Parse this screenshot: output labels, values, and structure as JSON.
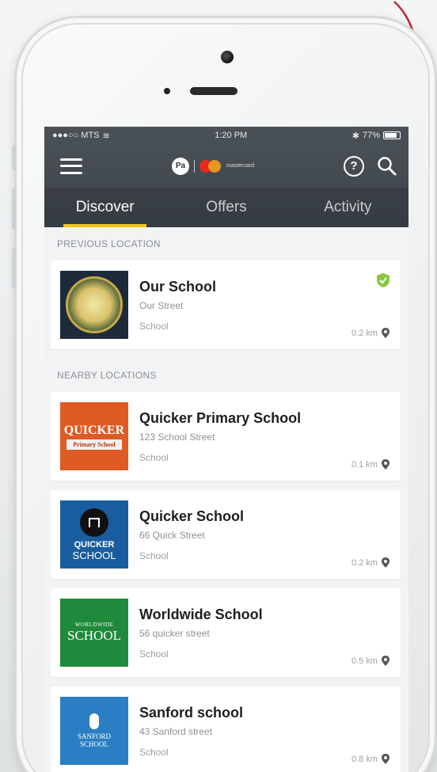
{
  "status_bar": {
    "carrier": "●●●○○ MTS",
    "time": "1:20 PM",
    "battery": "77%"
  },
  "header": {
    "brand_text": "mastercard",
    "icons": [
      "menu-icon",
      "help-icon",
      "search-icon"
    ]
  },
  "tabs": [
    {
      "label": "Discover",
      "active": true
    },
    {
      "label": "Offers",
      "active": false
    },
    {
      "label": "Activity",
      "active": false
    }
  ],
  "previous_section": {
    "label": "PREVIOUS LOCATION",
    "item": {
      "name": "Our School",
      "address": "Our Street",
      "type": "School",
      "distance": "0.2 km",
      "verified": true
    }
  },
  "nearby_section": {
    "label": "NEARBY LOCATIONS",
    "items": [
      {
        "name": "Quicker Primary School",
        "address": "123 School Street",
        "type": "School",
        "distance": "0.1 km",
        "logo_text": "QUICKER",
        "logo_subtext": "Primary School"
      },
      {
        "name": "Quicker School",
        "address": "66 Quick Street",
        "type": "School",
        "distance": "0.2 km",
        "logo_text": "QUICKER",
        "logo_subtext": "SCHOOL"
      },
      {
        "name": "Worldwide School",
        "address": "56 quicker street",
        "type": "School",
        "distance": "0.5 km",
        "logo_text": "WORLDWIDE",
        "logo_subtext": "SCHOOL"
      },
      {
        "name": "Sanford school",
        "address": "43 Sanford street",
        "type": "School",
        "distance": "0.8 km",
        "logo_text": "SANFORD",
        "logo_subtext": "SCHOOL"
      }
    ]
  },
  "colors": {
    "header": "#3d444a",
    "tab_indicator": "#f5c518",
    "verified": "#8cc63f",
    "annotation_arrow": "#c0272d"
  }
}
